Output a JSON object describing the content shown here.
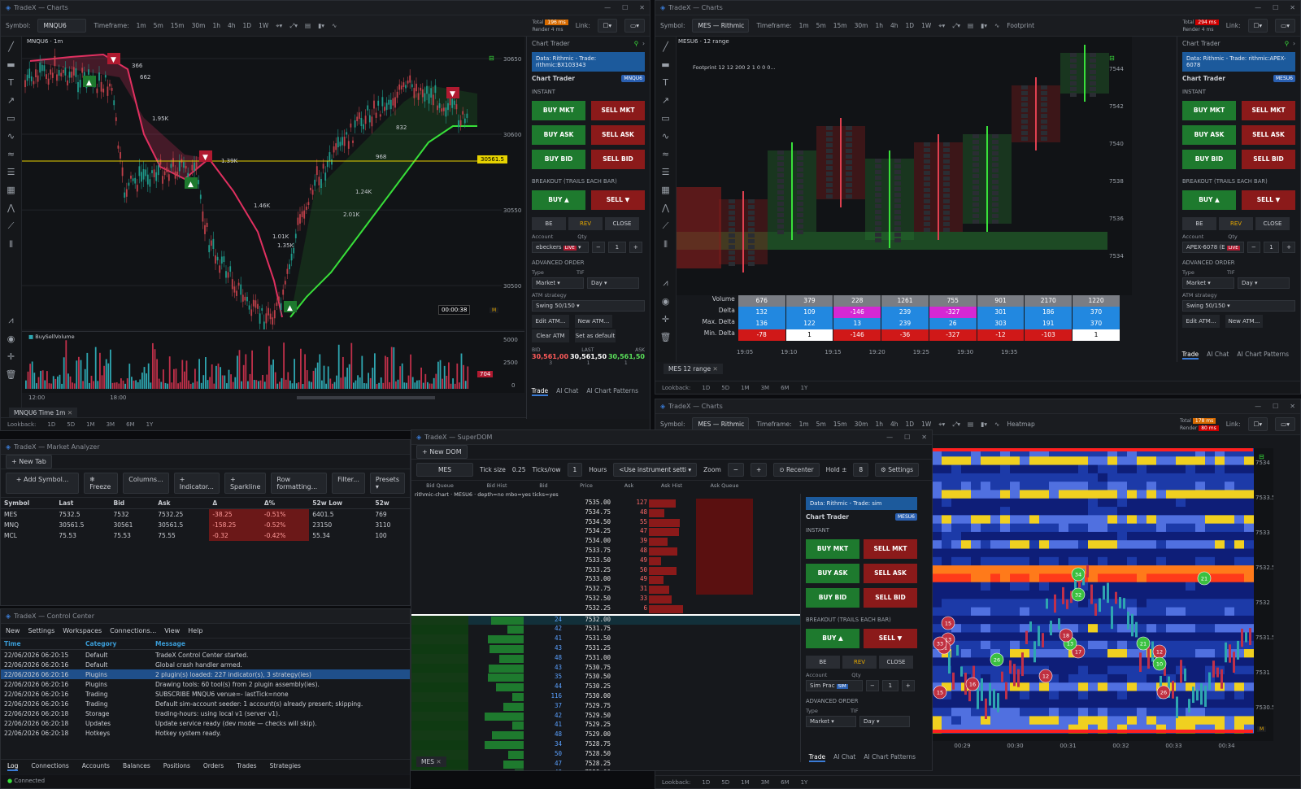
{
  "app_name": "TradeX",
  "win1": {
    "title": "TradeX — Charts",
    "symbol_label": "Symbol:",
    "symbol": "MNQU6",
    "timeframe_label": "Timeframe:",
    "timeframes": [
      "1m",
      "5m",
      "15m",
      "30m",
      "1h",
      "4h",
      "1D",
      "1W"
    ],
    "total_label": "Total",
    "total_val": "196 ms",
    "render_label": "Render",
    "render_val": "4 ms",
    "link_label": "Link:",
    "chart_header": "MNQU6 · 1m",
    "y_ticks": [
      "30650",
      "30600",
      "30550",
      "30500",
      "30450",
      "30400"
    ],
    "price_tag": "30561.5",
    "timer": "00:00:38",
    "vol_ticks": [
      "5000",
      "2500",
      "0"
    ],
    "vol_tag": "704",
    "volume_label": "BuySellVolume",
    "x_ticks": [
      "12:00",
      "18:00"
    ],
    "annotations": [
      "366",
      "662",
      "1.95K",
      "1.39K",
      "832",
      "968",
      "1.24K",
      "2.01K",
      "1.46K",
      "1.01K",
      "1.35K"
    ],
    "tab": "MNQU6 Time 1m",
    "lookback_label": "Lookback:",
    "lookbacks": [
      "1D",
      "5D",
      "1M",
      "3M",
      "6M",
      "1Y"
    ]
  },
  "ct1": {
    "title": "Chart Trader",
    "info": "Data: Rithmic - Trade: rithmic:BX103343",
    "heading": "Chart Trader",
    "sym": "MNQU6",
    "instant": "INSTANT",
    "buy_mkt": "BUY MKT",
    "sell_mkt": "SELL MKT",
    "buy_ask": "BUY ASK",
    "sell_ask": "SELL ASK",
    "buy_bid": "BUY BID",
    "sell_bid": "SELL BID",
    "breakout": "BREAKOUT (TRAILS EACH BAR)",
    "buy_up": "BUY ▲",
    "sell_dn": "SELL ▼",
    "be": "BE",
    "rev": "REV",
    "close": "CLOSE",
    "account_label": "Account",
    "qty_label": "Qty",
    "account": "ebeckers",
    "live": "LIVE",
    "qty": "1",
    "adv": "ADVANCED ORDER",
    "type_label": "Type",
    "tif_label": "TIF",
    "type": "Market",
    "tif": "Day",
    "atm_label": "ATM strategy",
    "atm": "Swing 50/150",
    "edit_atm": "Edit ATM...",
    "new_atm": "New ATM...",
    "clear_atm": "Clear ATM",
    "set_default": "Set as default",
    "bid_label": "BID",
    "last_label": "LAST",
    "ask_label": "ASK",
    "bid": "30,561,00",
    "last": "30,561,50",
    "ask": "30,561,50",
    "bid_sz": "3",
    "last_sz": "1",
    "ask_sz": "1",
    "tabs": [
      "Trade",
      "AI Chat",
      "AI Chart Patterns"
    ]
  },
  "win2": {
    "title": "TradeX — Charts",
    "symbol": "MES — Rithmic",
    "chart_type": "Footprint",
    "total_val": "294 ms",
    "render_val": "4 ms",
    "chart_header": "MESU6 · 12 range",
    "fp_label": "Footprint 12 12 200 2 1 0 0 0...",
    "y_ticks": [
      "7544",
      "7542",
      "7540",
      "7538",
      "7536",
      "7534"
    ],
    "row_labels": [
      "Volume",
      "Delta",
      "Max. Delta",
      "Min. Delta"
    ],
    "volume": [
      "676",
      "379",
      "228",
      "1261",
      "755",
      "901",
      "2170",
      "1220"
    ],
    "delta": [
      "132",
      "109",
      "-146",
      "239",
      "-327",
      "301",
      "186",
      "370"
    ],
    "max_delta": [
      "136",
      "122",
      "13",
      "239",
      "26",
      "303",
      "191",
      "370"
    ],
    "min_delta": [
      "-78",
      "1",
      "-146",
      "-36",
      "-327",
      "-12",
      "-103",
      "1"
    ],
    "x_ticks": [
      "19:05",
      "19:10",
      "19:15",
      "19:20",
      "19:25",
      "19:30",
      "19:35"
    ],
    "tab": "MES 12 range",
    "lookbacks": [
      "1D",
      "5D",
      "1M",
      "3M",
      "6M",
      "1Y"
    ]
  },
  "ct2": {
    "info": "Data: Rithmic - Trade: rithmic:APEX-6078",
    "sym": "MESU6",
    "account": "APEX-6078 (E",
    "live": "LIVE",
    "qty": "1",
    "type": "Market",
    "tif": "Day",
    "atm": "Swing 50/150"
  },
  "win3": {
    "title": "TradeX — Charts",
    "symbol": "MES — Rithmic",
    "chart_type": "Heatmap",
    "total_val": "178 ms",
    "render_val": "80 ms",
    "y_ticks": [
      "7534",
      "7533.5",
      "7533",
      "7532.5",
      "7532",
      "7531.5",
      "7531",
      "7530.5"
    ],
    "x_ticks": [
      "00:29",
      "00:30",
      "00:31",
      "00:32",
      "00:33",
      "00:34"
    ],
    "bubbles": [
      "34",
      "32",
      "21",
      "15",
      "13",
      "21",
      "33",
      "26",
      "17",
      "13",
      "16",
      "12",
      "18",
      "21",
      "12",
      "10",
      "26",
      "15"
    ],
    "lookbacks": [
      "1D",
      "5D",
      "1M",
      "3M",
      "6M",
      "1Y"
    ]
  },
  "ma": {
    "title": "TradeX — Market Analyzer",
    "new_tab": "+ New Tab",
    "toolbar": [
      "+ Add Symbol...",
      "❄ Freeze",
      "Columns...",
      "+ Indicator...",
      "+ Sparkline",
      "Row formatting...",
      "Filter...",
      "Presets ▾"
    ],
    "headers": [
      "Symbol",
      "Last",
      "Bid",
      "Ask",
      "Δ",
      "Δ%",
      "52w Low",
      "52w"
    ],
    "rows": [
      [
        "MES",
        "7532.5",
        "7532",
        "7532.25",
        "-38.25",
        "-0.51%",
        "6401.5",
        "769"
      ],
      [
        "MNQ",
        "30561.5",
        "30561",
        "30561.5",
        "-158.25",
        "-0.52%",
        "23150",
        "3110"
      ],
      [
        "MCL",
        "75.53",
        "75.53",
        "75.55",
        "-0.32",
        "-0.42%",
        "55.34",
        "100"
      ]
    ]
  },
  "cc": {
    "title": "TradeX — Control Center",
    "menu": [
      "New",
      "Settings",
      "Workspaces",
      "Connections...",
      "View",
      "Help"
    ],
    "headers": [
      "Time",
      "Category",
      "Message"
    ],
    "rows": [
      [
        "22/06/2026 06:20:15",
        "Default",
        "TradeX Control Center started."
      ],
      [
        "22/06/2026 06:20:16",
        "Default",
        "Global crash handler armed."
      ],
      [
        "22/06/2026 06:20:16",
        "Plugins",
        "2 plugin(s) loaded: 227 indicator(s), 3 strategy(ies)"
      ],
      [
        "22/06/2026 06:20:16",
        "Plugins",
        "Drawing tools: 60 tool(s) from 2 plugin assembly(ies)."
      ],
      [
        "22/06/2026 06:20:16",
        "Trading",
        "SUBSCRIBE MNQU6 venue=- lastTick=none"
      ],
      [
        "22/06/2026 06:20:16",
        "Trading",
        "Default sim-account seeder: 1 account(s) already present; skipping."
      ],
      [
        "22/06/2026 06:20:18",
        "Storage",
        "trading-hours: using local v1 (server v1)."
      ],
      [
        "22/06/2026 06:20:18",
        "Updates",
        "Update service ready (dev mode — checks will skip)."
      ],
      [
        "22/06/2026 06:20:18",
        "Hotkeys",
        "Hotkey system ready."
      ]
    ],
    "tabs": [
      "Log",
      "Connections",
      "Accounts",
      "Balances",
      "Positions",
      "Orders",
      "Trades",
      "Strategies"
    ],
    "status": "Connected"
  },
  "dom": {
    "title": "TradeX — SuperDOM",
    "new_dom": "+ New DOM",
    "symbol": "MES",
    "tick_label": "Tick size",
    "tick": "0.25",
    "ticks_row_label": "Ticks/row",
    "ticks_row": "1",
    "hours_label": "Hours",
    "hours": "<Use instrument setti",
    "zoom_label": "Zoom",
    "recenter": "⊙ Recenter",
    "hold_label": "Hold ±",
    "hold": "8",
    "settings": "⚙ Settings",
    "cols": [
      "Bid Queue",
      "Bid Hist",
      "Bid",
      "Price",
      "Ask",
      "Ask Hist",
      "Ask Queue"
    ],
    "info": "rithmic-chart · MESU6 · depth=no mbo=yes ticks=yes",
    "asks": [
      [
        "7535.00",
        "127"
      ],
      [
        "7534.75",
        "48"
      ],
      [
        "7534.50",
        "55"
      ],
      [
        "7534.25",
        "47"
      ],
      [
        "7534.00",
        "39"
      ],
      [
        "7533.75",
        "48"
      ],
      [
        "7533.50",
        "49"
      ],
      [
        "7533.25",
        "50"
      ],
      [
        "7533.00",
        "49"
      ],
      [
        "7532.75",
        "31"
      ],
      [
        "7532.50",
        "33"
      ],
      [
        "7532.25",
        "6"
      ]
    ],
    "bids": [
      [
        "7532.00",
        "24"
      ],
      [
        "7531.75",
        "42"
      ],
      [
        "7531.50",
        "41"
      ],
      [
        "7531.25",
        "43"
      ],
      [
        "7531.00",
        "48"
      ],
      [
        "7530.75",
        "43"
      ],
      [
        "7530.50",
        "35"
      ],
      [
        "7530.25",
        "44"
      ],
      [
        "7530.00",
        "116"
      ],
      [
        "7529.75",
        "37"
      ],
      [
        "7529.50",
        "42"
      ],
      [
        "7529.25",
        "41"
      ],
      [
        "7529.00",
        "48"
      ],
      [
        "7528.75",
        "34"
      ],
      [
        "7528.50",
        "50"
      ],
      [
        "7528.25",
        "47"
      ],
      [
        "7528.00",
        "48"
      ],
      [
        "7527.75",
        "45"
      ]
    ],
    "tab": "MES"
  },
  "ct3": {
    "info": "Data: Rithmic - Trade: sim",
    "sym": "MESU6",
    "account": "Sim Prac",
    "live": "SIM",
    "qty": "1",
    "type": "Market",
    "tif": "Day"
  },
  "colors": {
    "buy": "#1e7a2e",
    "sell": "#8b1a1a",
    "accent": "#1c5a9c",
    "price_line": "#e6d200"
  }
}
